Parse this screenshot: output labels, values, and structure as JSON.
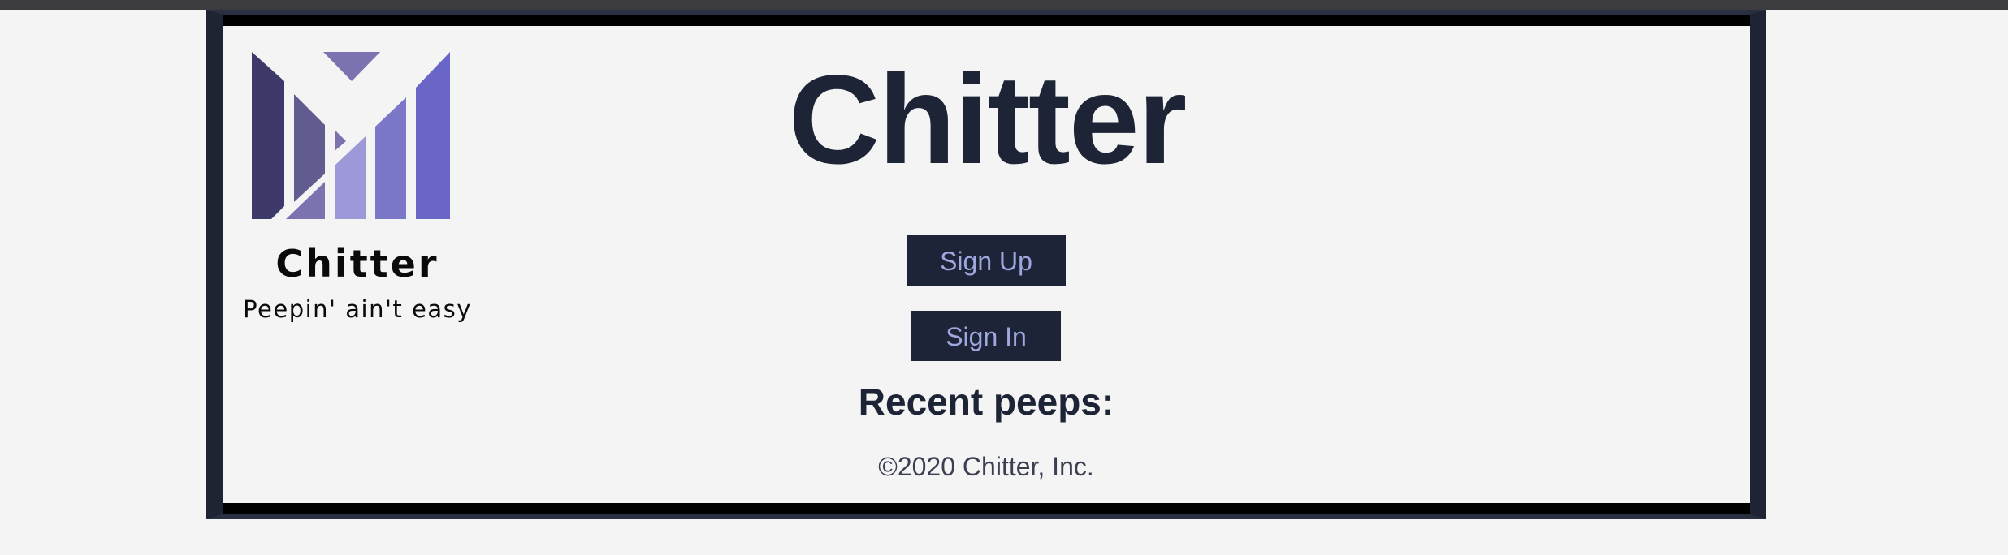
{
  "header": {
    "title": "Chitter"
  },
  "logo": {
    "icon": "chitter-m-logo",
    "name": "Chitter",
    "tagline": "Peepin' ain't easy",
    "colors": [
      "#3d3a6b",
      "#615c8f",
      "#7a73b0",
      "#9d99d8",
      "#6a66c7"
    ]
  },
  "actions": {
    "signup_label": "Sign Up",
    "signin_label": "Sign In"
  },
  "feed": {
    "heading": "Recent peeps:"
  },
  "footer": {
    "copyright": "©2020 Chitter, Inc."
  },
  "theme": {
    "primary_dark": "#1e2438",
    "button_text": "#9ea8df",
    "background": "#f4f4f4"
  }
}
